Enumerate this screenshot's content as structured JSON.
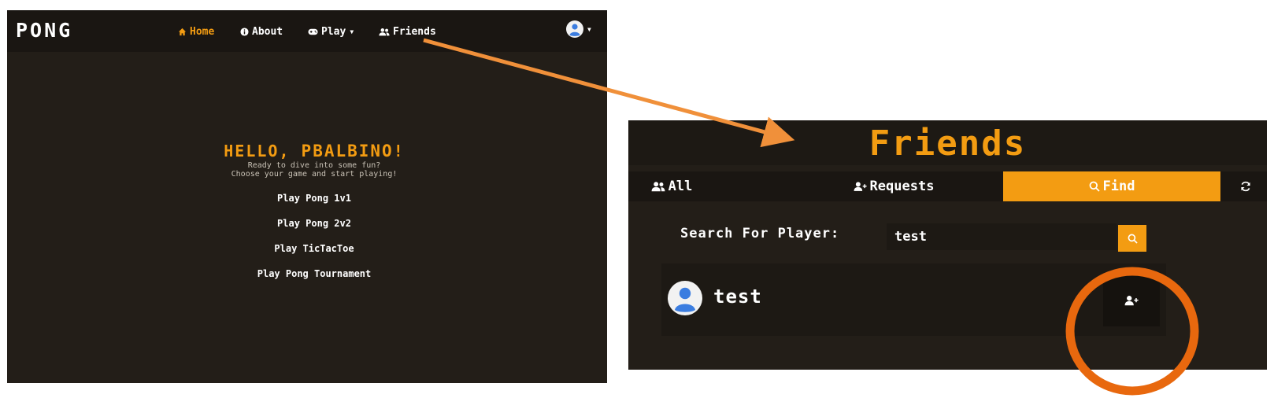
{
  "home": {
    "brand": "PONG",
    "nav": {
      "home": "Home",
      "about": "About",
      "play": "Play",
      "friends": "Friends"
    },
    "greeting_prefix": "HELLO, ",
    "username": "PBALBINO",
    "greeting_suffix": "!",
    "subtitle_line1": "Ready to dive into some fun?",
    "subtitle_line2": "Choose your game and start playing!",
    "play_links": [
      "Play Pong 1v1",
      "Play Pong 2v2",
      "Play TicTacToe",
      "Play Pong Tournament"
    ]
  },
  "friends": {
    "title": "Friends",
    "tabs": {
      "all": "All",
      "requests": "Requests",
      "find": "Find"
    },
    "search_label": "Search For Player:",
    "search_value": "test",
    "results": [
      {
        "name": "test"
      }
    ]
  },
  "colors": {
    "accent": "#f39c12",
    "background": "#231e18",
    "annotation_arrow": "#f0903a",
    "annotation_circle": "#e8680e"
  }
}
